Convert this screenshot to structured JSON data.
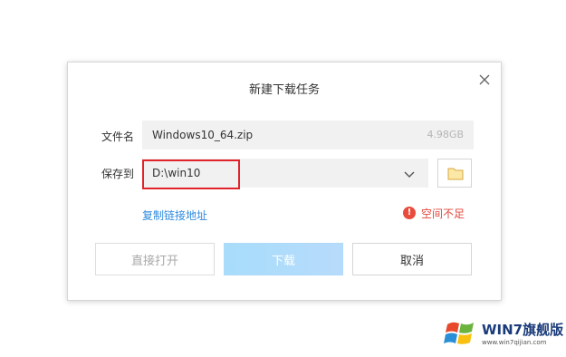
{
  "dialog": {
    "title": "新建下载任务",
    "filename_label": "文件名",
    "filename_value": "Windows10_64.zip",
    "filesize": "4.98GB",
    "saveto_label": "保存到",
    "saveto_value": "D:\\win10",
    "copy_link": "复制链接地址",
    "warning": "空间不足",
    "warning_icon": "!",
    "buttons": {
      "open": "直接打开",
      "download": "下载",
      "cancel": "取消"
    }
  },
  "colors": {
    "link": "#2e8bde",
    "warning": "#e84c3d",
    "highlight_box": "#e0242a",
    "download_button": "#a8dcfb"
  },
  "icons": {
    "close": "close-icon",
    "dropdown": "chevron-down-icon",
    "folder": "folder-icon",
    "warning": "warning-icon"
  },
  "watermark": {
    "brand": "WIN7旗舰版",
    "site": "www.win7qijian.com"
  }
}
